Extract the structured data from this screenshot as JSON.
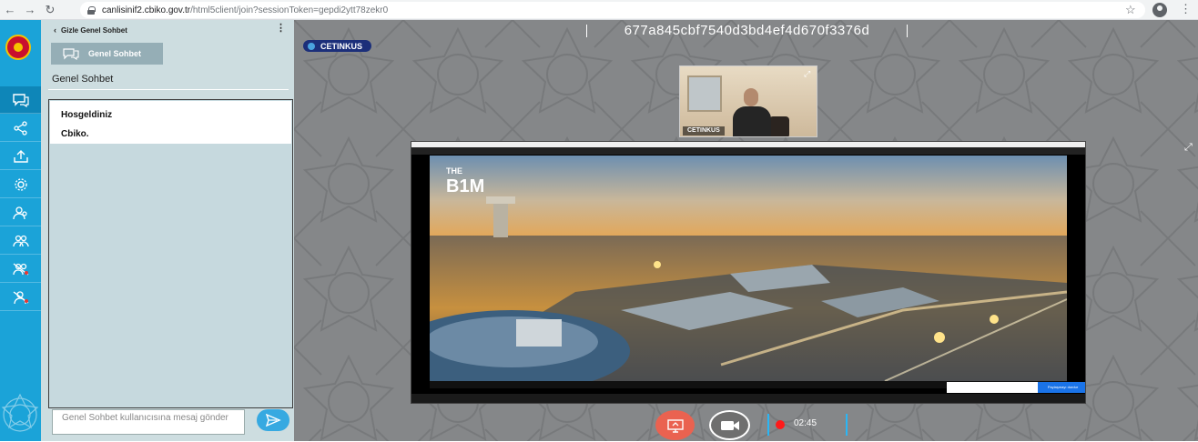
{
  "browser": {
    "host": "canlisinif2.cbiko.gov.tr",
    "path": "/html5client/join?sessionToken=gepdi2ytt78zekr0"
  },
  "chat": {
    "hide_label": "Gizle Genel Sohbet",
    "tab_button_label": "Genel Sohbet",
    "title": "Genel Sohbet",
    "messages": [
      {
        "text": "Hosgeldiniz"
      },
      {
        "text": "Cbiko."
      }
    ],
    "input_placeholder": "Genel Sohbet kullanıcısına mesaj gönder"
  },
  "main": {
    "session_id": "677a845cbf7540d3bd4ef4d670f3376d",
    "presenter_name": "CETINKUS",
    "webcam_name": "CETINKUS",
    "recording_time": "02:45"
  },
  "screen_share": {
    "brand_text": "THE B1M",
    "notify_button": "Paylaşmayı durdur"
  },
  "colors": {
    "rail": "#1ba3d8",
    "chat_panel": "#cddde0",
    "main_bg": "#858789",
    "share_button": "#ea6250",
    "recording": "#ff1a1a",
    "badge": "#1c2f7a"
  }
}
